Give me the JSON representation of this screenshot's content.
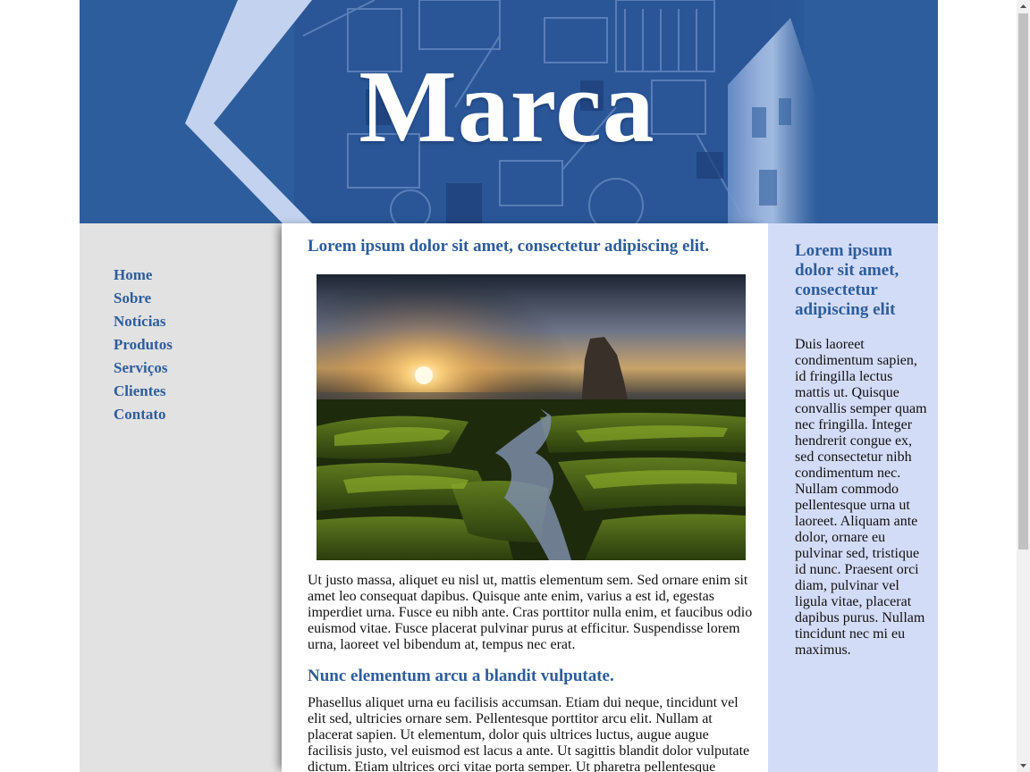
{
  "header": {
    "brand": "Marca"
  },
  "nav": {
    "items": [
      {
        "label": "Home"
      },
      {
        "label": "Sobre"
      },
      {
        "label": "Notícias"
      },
      {
        "label": "Produtos"
      },
      {
        "label": "Serviços"
      },
      {
        "label": "Clientes"
      },
      {
        "label": "Contato"
      }
    ]
  },
  "main": {
    "title": "Lorem ipsum dolor sit amet, consectetur adipiscing elit.",
    "paragraph1": "Ut justo massa, aliquet eu nisl ut, mattis elementum sem. Sed ornare enim sit amet leo consequat dapibus. Quisque ante enim, varius a est id, egestas imperdiet urna. Fusce eu nibh ante. Cras porttitor nulla enim, et faucibus odio euismod vitae. Fusce placerat pulvinar purus at efficitur. Suspendisse lorem urna, laoreet vel bibendum at, tempus nec erat.",
    "subtitle": "Nunc elementum arcu a blandit vulputate.",
    "paragraph2": "Phasellus aliquet urna eu facilisis accumsan. Etiam dui neque, tincidunt vel elit sed, ultricies ornare sem. Pellentesque porttitor arcu elit. Nullam at placerat sapien. Ut elementum, dolor quis ultrices luctus, augue augue facilisis justo, vel euismod est lacus a ante. Ut sagittis blandit dolor vulputate dictum. Etiam ultrices orci vitae porta semper. Ut pharetra pellentesque"
  },
  "aside": {
    "title": "Lorem ipsum dolor sit amet, consectetur adipiscing elit",
    "text": "Duis laoreet condimentum sapien, id fringilla lectus mattis ut. Quisque convallis semper quam nec fringilla. Integer hendrerit congue ex, sed consectetur nibh condimentum nec. Nullam commodo pellentesque urna ut laoreet. Aliquam ante dolor, ornare eu pulvinar sed, tristique id nunc. Praesent orci diam, pulvinar vel ligula vitae, placerat dapibus purus. Nullam tincidunt nec mi eu maximus."
  },
  "colors": {
    "header_blue": "#2d5d9c",
    "link_blue": "#2d5d9c",
    "nav_bg": "#e2e2e2",
    "aside_bg": "#d3dcf7",
    "chevron": "#c3d2ef"
  }
}
